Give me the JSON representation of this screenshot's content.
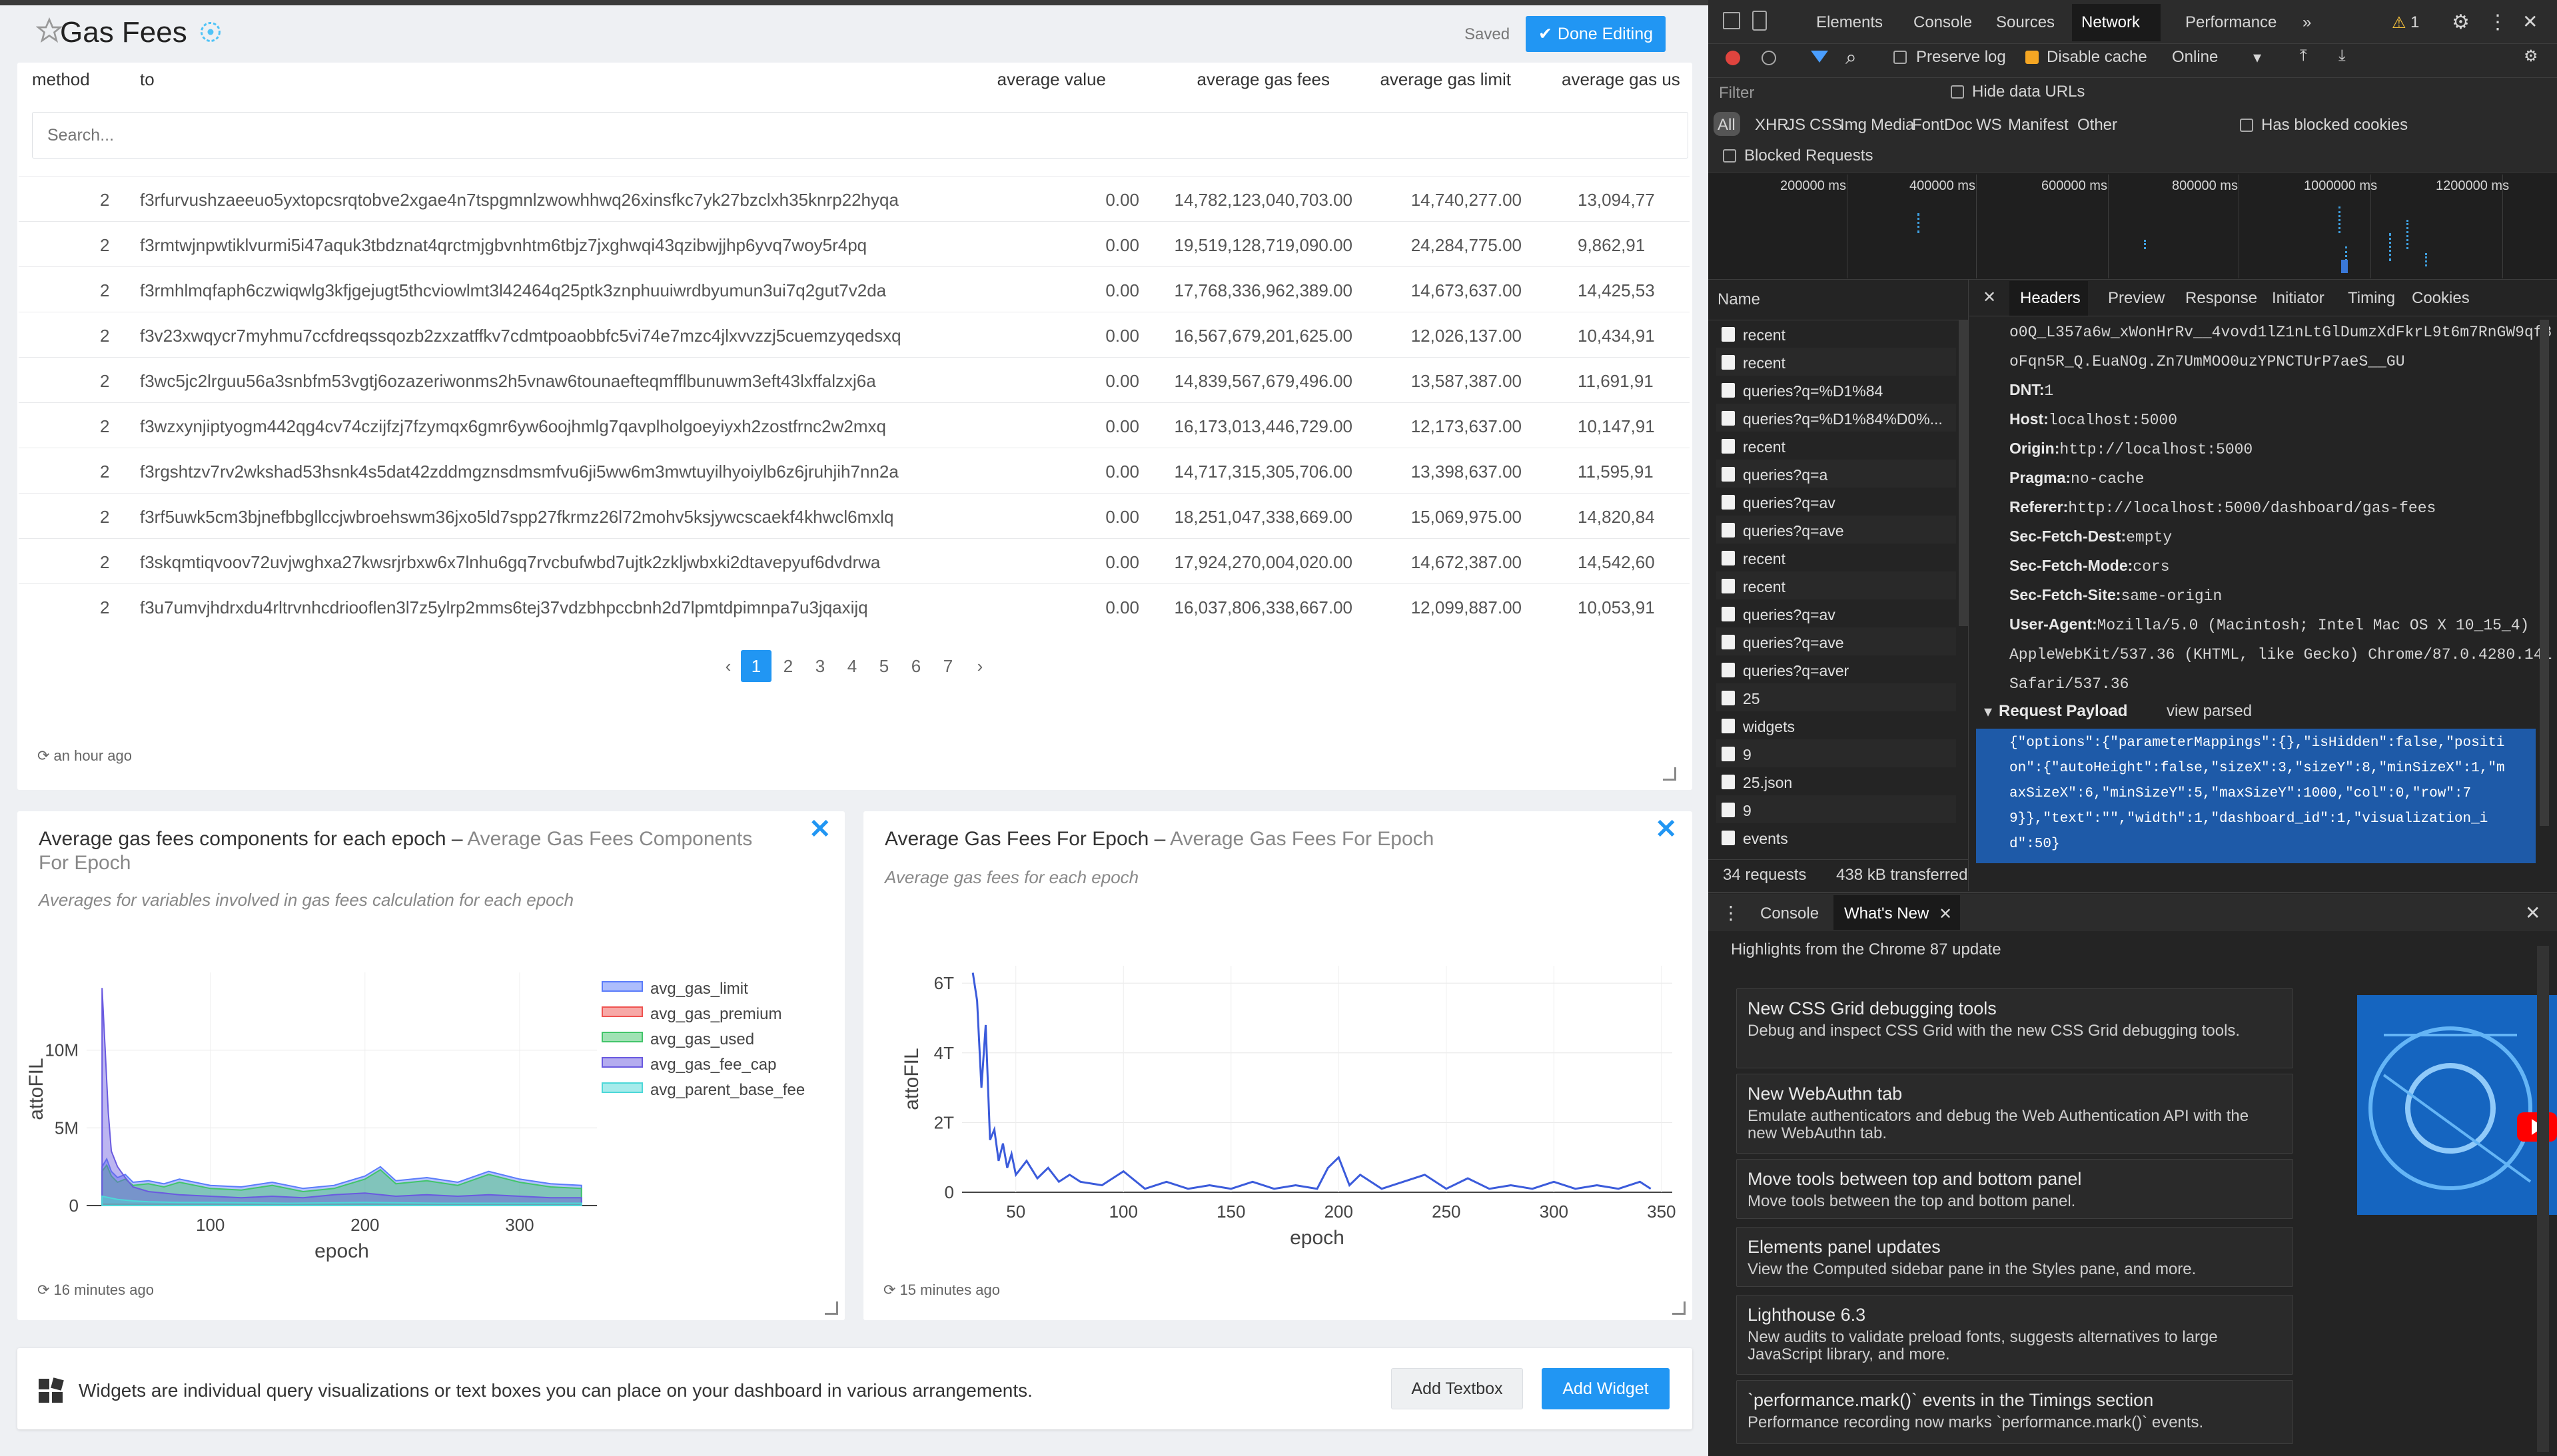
{
  "dashboard": {
    "title": "Gas Fees",
    "saved_label": "Saved",
    "done_editing_label": "Done Editing",
    "columns": [
      "method",
      "to",
      "average value",
      "average gas fees",
      "average gas limit",
      "average gas us"
    ],
    "search_placeholder": "Search...",
    "rows": [
      [
        "2",
        "f3rfurvushzaeeuo5yxtopcsrqtobve2xgae4n7tspgmnlzwowhhwq26xinsfkc7yk27bzclxh35knrp22hyqa",
        "0.00",
        "14,782,123,040,703.00",
        "14,740,277.00",
        "13,094,77"
      ],
      [
        "2",
        "f3rmtwjnpwtiklvurmi5i47aquk3tbdznat4qrctmjgbvnhtm6tbjz7jxghwqi43qzibwjjhp6yvq7woy5r4pq",
        "0.00",
        "19,519,128,719,090.00",
        "24,284,775.00",
        "9,862,91"
      ],
      [
        "2",
        "f3rmhlmqfaph6czwiqwlg3kfjgejugt5thcviowlmt3l42464q25ptk3znphuuiwrdbyumun3ui7q2gut7v2da",
        "0.00",
        "17,768,336,962,389.00",
        "14,673,637.00",
        "14,425,53"
      ],
      [
        "2",
        "f3v23xwqycr7myhmu7ccfdreqssqozb2zxzatffkv7cdmtpoaobbfc5vi74e7mzc4jlxvvzzj5cuemzyqedsxq",
        "0.00",
        "16,567,679,201,625.00",
        "12,026,137.00",
        "10,434,91"
      ],
      [
        "2",
        "f3wc5jc2lrguu56a3snbfm53vgtj6ozazeriwonms2h5vnaw6tounaefteqmfflbunuwm3eft43lxffalzxj6a",
        "0.00",
        "14,839,567,679,496.00",
        "13,587,387.00",
        "11,691,91"
      ],
      [
        "2",
        "f3wzxynjiptyogm442qg4cv74czijfzj7fzymqx6gmr6yw6oojhmlg7qavplholgoeyiyxh2zostfrnc2w2mxq",
        "0.00",
        "16,173,013,446,729.00",
        "12,173,637.00",
        "10,147,91"
      ],
      [
        "2",
        "f3rgshtzv7rv2wkshad53hsnk4s5dat42zddmgznsdmsmfvu6ji5ww6m3mwtuyilhyoiylb6z6jruhjih7nn2a",
        "0.00",
        "14,717,315,305,706.00",
        "13,398,637.00",
        "11,595,91"
      ],
      [
        "2",
        "f3rf5uwk5cm3bjnefbbgllccjwbroehswm36jxo5ld7spp27fkrmz26l72mohv5ksjywcscaekf4khwcl6mxlq",
        "0.00",
        "18,251,047,338,669.00",
        "15,069,975.00",
        "14,820,84"
      ],
      [
        "2",
        "f3skqmtiqvoov72uvjwghxa27kwsrjrbxw6x7lnhu6gq7rvcbufwbd7ujtk2zkljwbxki2dtavepyuf6dvdrwa",
        "0.00",
        "17,924,270,004,020.00",
        "14,672,387.00",
        "14,542,60"
      ],
      [
        "2",
        "f3u7umvjhdrxdu4rltrvnhcdriooflen3l7z5ylrp2mms6tej37vdzbhpccbnh2d7lpmtdpimnpa7u3jqaxijq",
        "0.00",
        "16,037,806,338,667.00",
        "12,099,887.00",
        "10,053,91"
      ]
    ],
    "pagination": {
      "prev": "‹",
      "pages": [
        "1",
        "2",
        "3",
        "4",
        "5",
        "6",
        "7"
      ],
      "next": "›",
      "current": "1"
    },
    "table_updated": "an hour ago",
    "widget1": {
      "title": "Average gas fees components for each epoch",
      "dash": " – ",
      "subtitle": "Average Gas Fees Components For Epoch",
      "description": "Averages for variables involved in gas fees calculation for each epoch",
      "updated": "16 minutes ago",
      "close": "✕"
    },
    "widget2": {
      "title": "Average Gas Fees For Epoch",
      "dash": " – ",
      "subtitle": "Average Gas Fees For Epoch",
      "description": "Average gas fees for each epoch",
      "updated": "15 minutes ago",
      "close": "✕"
    },
    "footer": {
      "text": "Widgets are individual query visualizations or text boxes you can place on your dashboard in various arrangements.",
      "add_textbox": "Add Textbox",
      "add_widget": "Add Widget"
    }
  },
  "chart_data": [
    {
      "type": "area",
      "xlabel": "epoch",
      "ylabel": "attoFIL",
      "xlim": [
        20,
        350
      ],
      "ylim": [
        0,
        15000000
      ],
      "xticks": [
        "100",
        "200",
        "300"
      ],
      "yticks": [
        "0",
        "5M",
        "10M"
      ],
      "legend_position": "right",
      "series": [
        {
          "name": "avg_gas_limit",
          "color": "#5b7cfa",
          "x": [
            30,
            33,
            36,
            40,
            45,
            50,
            60,
            70,
            80,
            100,
            120,
            140,
            160,
            180,
            200,
            210,
            220,
            240,
            260,
            280,
            300,
            320,
            340
          ],
          "values": [
            2500000,
            3000000,
            2200000,
            1800000,
            2000000,
            1500000,
            1600000,
            1400000,
            1700000,
            1300000,
            1200000,
            1500000,
            1100000,
            1300000,
            1900000,
            2500000,
            1600000,
            1800000,
            1500000,
            2200000,
            1700000,
            1400000,
            1300000
          ]
        },
        {
          "name": "avg_gas_premium",
          "color": "#ef5350",
          "x": [
            30,
            100,
            200,
            300,
            340
          ],
          "values": [
            100000,
            80000,
            90000,
            80000,
            70000
          ]
        },
        {
          "name": "avg_gas_used",
          "color": "#42c56a",
          "x": [
            30,
            33,
            36,
            40,
            45,
            50,
            60,
            70,
            80,
            100,
            120,
            140,
            160,
            180,
            200,
            210,
            220,
            240,
            260,
            280,
            300,
            320,
            340
          ],
          "values": [
            2200000,
            2600000,
            1900000,
            1500000,
            1700000,
            1300000,
            1400000,
            1200000,
            1500000,
            1100000,
            1000000,
            1300000,
            900000,
            1100000,
            1700000,
            2300000,
            1400000,
            1600000,
            1300000,
            2000000,
            1500000,
            1200000,
            1100000
          ]
        },
        {
          "name": "avg_gas_fee_cap",
          "color": "#6a5ae0",
          "x": [
            30,
            32,
            34,
            36,
            40,
            45,
            50,
            60,
            70,
            80,
            100,
            120,
            140,
            160,
            180,
            200,
            220,
            240,
            260,
            280,
            300,
            320,
            340
          ],
          "values": [
            14000000,
            10000000,
            6000000,
            3500000,
            2500000,
            1800000,
            1200000,
            900000,
            800000,
            700000,
            600000,
            500000,
            600000,
            500000,
            700000,
            800000,
            600000,
            700000,
            600000,
            700000,
            600000,
            500000,
            500000
          ]
        },
        {
          "name": "avg_parent_base_fee",
          "color": "#4dd8d8",
          "x": [
            30,
            35,
            40,
            50,
            60,
            80,
            100,
            150,
            200,
            250,
            300,
            340
          ],
          "values": [
            600000,
            500000,
            400000,
            300000,
            250000,
            200000,
            200000,
            150000,
            200000,
            150000,
            150000,
            150000
          ]
        }
      ]
    },
    {
      "type": "line",
      "xlabel": "epoch",
      "ylabel": "attoFIL",
      "xlim": [
        25,
        355
      ],
      "ylim": [
        0,
        6500000000000
      ],
      "xticks": [
        "50",
        "100",
        "150",
        "200",
        "250",
        "300",
        "350"
      ],
      "yticks": [
        "0",
        "2T",
        "4T",
        "6T"
      ],
      "series": [
        {
          "name": "",
          "color": "#3b5bdb",
          "x": [
            30,
            32,
            34,
            36,
            38,
            40,
            42,
            44,
            46,
            48,
            50,
            55,
            60,
            65,
            70,
            75,
            80,
            90,
            100,
            110,
            120,
            130,
            140,
            150,
            160,
            170,
            180,
            190,
            195,
            200,
            205,
            210,
            220,
            230,
            240,
            250,
            260,
            270,
            280,
            290,
            300,
            310,
            320,
            330,
            340,
            345
          ],
          "values": [
            6300000000000,
            5500000000000,
            3000000000000,
            4800000000000,
            1500000000000,
            1800000000000,
            900000000000,
            1400000000000,
            700000000000,
            1100000000000,
            500000000000,
            900000000000,
            400000000000,
            700000000000,
            300000000000,
            500000000000,
            300000000000,
            200000000000,
            600000000000,
            100000000000,
            300000000000,
            100000000000,
            200000000000,
            100000000000,
            300000000000,
            100000000000,
            200000000000,
            100000000000,
            700000000000,
            1000000000000,
            200000000000,
            500000000000,
            100000000000,
            300000000000,
            500000000000,
            100000000000,
            400000000000,
            100000000000,
            200000000000,
            100000000000,
            300000000000,
            100000000000,
            200000000000,
            100000000000,
            300000000000,
            100000000000
          ]
        }
      ]
    }
  ],
  "devtools": {
    "tabs": [
      "Elements",
      "Console",
      "Sources",
      "Network",
      "Performance",
      "»"
    ],
    "active_tab": "Network",
    "warning_count": "1",
    "toolbar": {
      "preserve_log": "Preserve log",
      "disable_cache": "Disable cache",
      "throttle": "Online"
    },
    "filter_placeholder": "Filter",
    "hide_data_urls": "Hide data URLs",
    "types": [
      "All",
      "XHR",
      "JS",
      "CSS",
      "Img",
      "Media",
      "Font",
      "Doc",
      "WS",
      "Manifest",
      "Other"
    ],
    "has_blocked_cookies": "Has blocked cookies",
    "blocked_requests": "Blocked Requests",
    "timeline_ticks": [
      "200000 ms",
      "400000 ms",
      "600000 ms",
      "800000 ms",
      "1000000 ms",
      "1200000 ms"
    ],
    "name_header": "Name",
    "requests": [
      "recent",
      "recent",
      "queries?q=%D1%84",
      "queries?q=%D1%84%D0%...",
      "recent",
      "queries?q=a",
      "queries?q=av",
      "queries?q=ave",
      "recent",
      "recent",
      "queries?q=av",
      "queries?q=ave",
      "queries?q=aver",
      "25",
      "widgets",
      "9",
      "25.json",
      "9",
      "events"
    ],
    "detail_tabs": [
      "Headers",
      "Preview",
      "Response",
      "Initiator",
      "Timing",
      "Cookies"
    ],
    "close_detail": "✕",
    "headers": [
      {
        "k": "",
        "v": "o0Q_L357a6w_xWonHrRv__4vovd1lZ1nLtGlDumzXdFkrL9t6m7RnGW9qf8"
      },
      {
        "k": "",
        "v": "oFqn5R_Q.EuaNOg.Zn7UmMOO0uzYPNCTUrP7aeS__GU"
      },
      {
        "k": "DNT:",
        "v": "1"
      },
      {
        "k": "Host:",
        "v": "localhost:5000"
      },
      {
        "k": "Origin:",
        "v": "http://localhost:5000"
      },
      {
        "k": "Pragma:",
        "v": "no-cache"
      },
      {
        "k": "Referer:",
        "v": "http://localhost:5000/dashboard/gas-fees"
      },
      {
        "k": "Sec-Fetch-Dest:",
        "v": "empty"
      },
      {
        "k": "Sec-Fetch-Mode:",
        "v": "cors"
      },
      {
        "k": "Sec-Fetch-Site:",
        "v": "same-origin"
      },
      {
        "k": "User-Agent:",
        "v": "Mozilla/5.0 (Macintosh; Intel Mac OS X 10_15_4)"
      },
      {
        "k": "",
        "v": "AppleWebKit/537.36 (KHTML, like Gecko) Chrome/87.0.4280.141"
      },
      {
        "k": "",
        "v": "Safari/537.36"
      }
    ],
    "payload_label": "Request Payload",
    "view_parsed": "view parsed",
    "payload_lines": [
      "{\"options\":{\"parameterMappings\":{},\"isHidden\":false,\"positi",
      "on\":{\"autoHeight\":false,\"sizeX\":3,\"sizeY\":8,\"minSizeX\":1,\"m",
      "axSizeX\":6,\"minSizeY\":5,\"maxSizeY\":1000,\"col\":0,\"row\":7",
      "9}},\"text\":\"\",\"width\":1,\"dashboard_id\":1,\"visualization_i",
      "d\":50}"
    ],
    "status_requests": "34 requests",
    "status_transferred": "438 kB transferred",
    "drawer_tabs": [
      "Console",
      "What's New"
    ],
    "highlights": "Highlights from the Chrome 87 update",
    "whats_new": [
      {
        "title": "New CSS Grid debugging tools",
        "desc": "Debug and inspect CSS Grid with the new CSS Grid debugging tools."
      },
      {
        "title": "New WebAuthn tab",
        "desc": "Emulate authenticators and debug the Web Authentication API with the new WebAuthn tab."
      },
      {
        "title": "Move tools between top and bottom panel",
        "desc": "Move tools between the top and bottom panel."
      },
      {
        "title": "Elements panel updates",
        "desc": "View the Computed sidebar pane in the Styles pane, and more."
      },
      {
        "title": "Lighthouse 6.3",
        "desc": "New audits to validate preload fonts, suggests alternatives to large JavaScript library, and more."
      },
      {
        "title": "`performance.mark()` events in the Timings section",
        "desc": "Performance recording now marks `performance.mark()` events."
      }
    ]
  }
}
